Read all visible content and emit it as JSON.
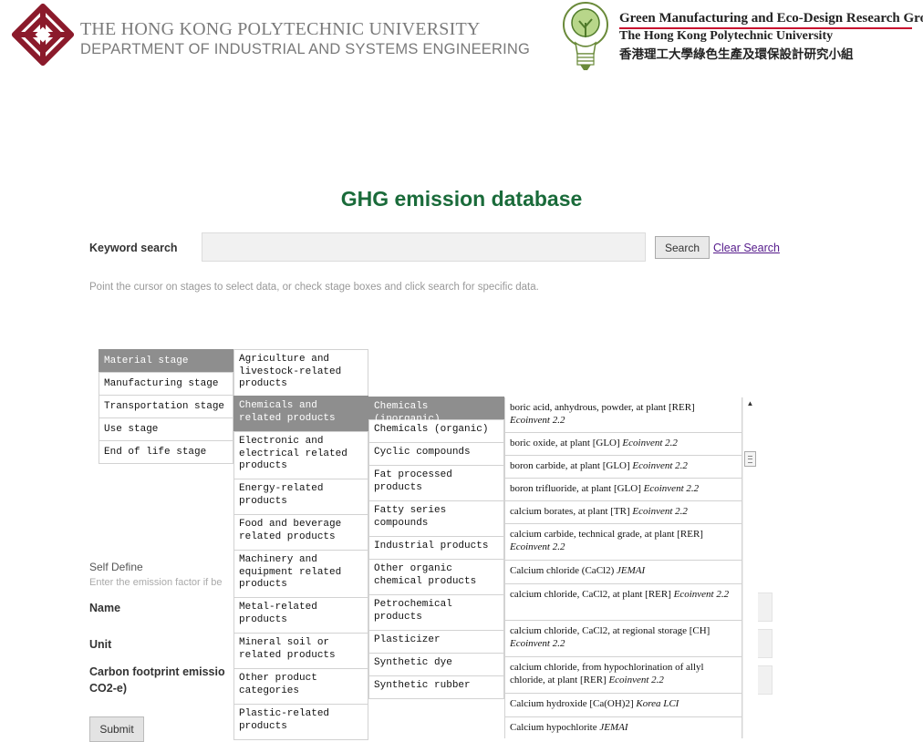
{
  "header": {
    "university": "THE HONG KONG POLYTECHNIC UNIVERSITY",
    "department": "DEPARTMENT OF INDUSTRIAL AND SYSTEMS ENGINEERING",
    "group_name": "Green Manufacturing and Eco-Design Research Group",
    "group_university": "The Hong Kong Polytechnic University",
    "group_chinese": "香港理工大學綠色生產及環保設計研究小組",
    "university_logo_icon": "polyu-logo-icon",
    "group_logo_icon": "lightbulb-tree-icon",
    "brand_color": "#8b1a2b"
  },
  "page_title": "GHG emission database",
  "search": {
    "label": "Keyword search",
    "value": "",
    "button_label": "Search",
    "clear_label": "Clear Search",
    "hint": "Point the cursor on stages to select data, or check stage boxes and click search for specific data."
  },
  "self_define": {
    "title": "Self Define",
    "hint": "Enter the emission factor if be",
    "name_label": "Name",
    "unit_label": "Unit",
    "carbon_label_line1": "Carbon footprint emissio",
    "carbon_label_line2": "CO2-e)",
    "submit_label": "Submit"
  },
  "menus": {
    "stages": [
      "Material stage",
      "Manufacturing stage",
      "Transportation stage",
      "Use stage",
      "End of life stage"
    ],
    "categories": [
      "Agriculture and livestock-related products",
      "Chemicals and related products",
      "Electronic and electrical related products",
      "Energy-related products",
      "Food and beverage related products",
      "Machinery and equipment related products",
      "Metal-related products",
      "Mineral soil or related products",
      "Other product categories",
      "Plastic-related products"
    ],
    "subcategories": [
      "Chemicals (inorganic)",
      "Chemicals (organic)",
      "Cyclic compounds",
      "Fat processed products",
      "Fatty series compounds",
      "Industrial products",
      "Other organic chemical products",
      "Petrochemical products",
      "Plasticizer",
      "Synthetic dye",
      "Synthetic rubber"
    ],
    "items": [
      {
        "name": "boric acid, anhydrous, powder, at plant [RER]",
        "source": "Ecoinvent 2.2"
      },
      {
        "name": "boric oxide, at plant [GLO]",
        "source": "Ecoinvent 2.2"
      },
      {
        "name": "boron carbide, at plant [GLO]",
        "source": "Ecoinvent 2.2"
      },
      {
        "name": "boron trifluoride, at plant [GLO]",
        "source": "Ecoinvent 2.2"
      },
      {
        "name": "calcium borates, at plant [TR]",
        "source": "Ecoinvent 2.2"
      },
      {
        "name": "calcium carbide, technical grade, at plant [RER]",
        "source": "Ecoinvent 2.2"
      },
      {
        "name": "Calcium chloride (CaCl2)",
        "source": "JEMAI"
      },
      {
        "name": "calcium chloride, CaCl2, at plant [RER]",
        "source": "Ecoinvent 2.2"
      },
      {
        "name": "calcium chloride, CaCl2, at regional storage [CH]",
        "source": "Ecoinvent 2.2"
      },
      {
        "name": "calcium chloride, from hypochlorination of allyl chloride, at plant [RER]",
        "source": "Ecoinvent 2.2"
      },
      {
        "name": "Calcium hydroxide [Ca(OH)2]",
        "source": "Korea LCI"
      },
      {
        "name": "Calcium hypochlorite",
        "source": "JEMAI"
      }
    ]
  }
}
